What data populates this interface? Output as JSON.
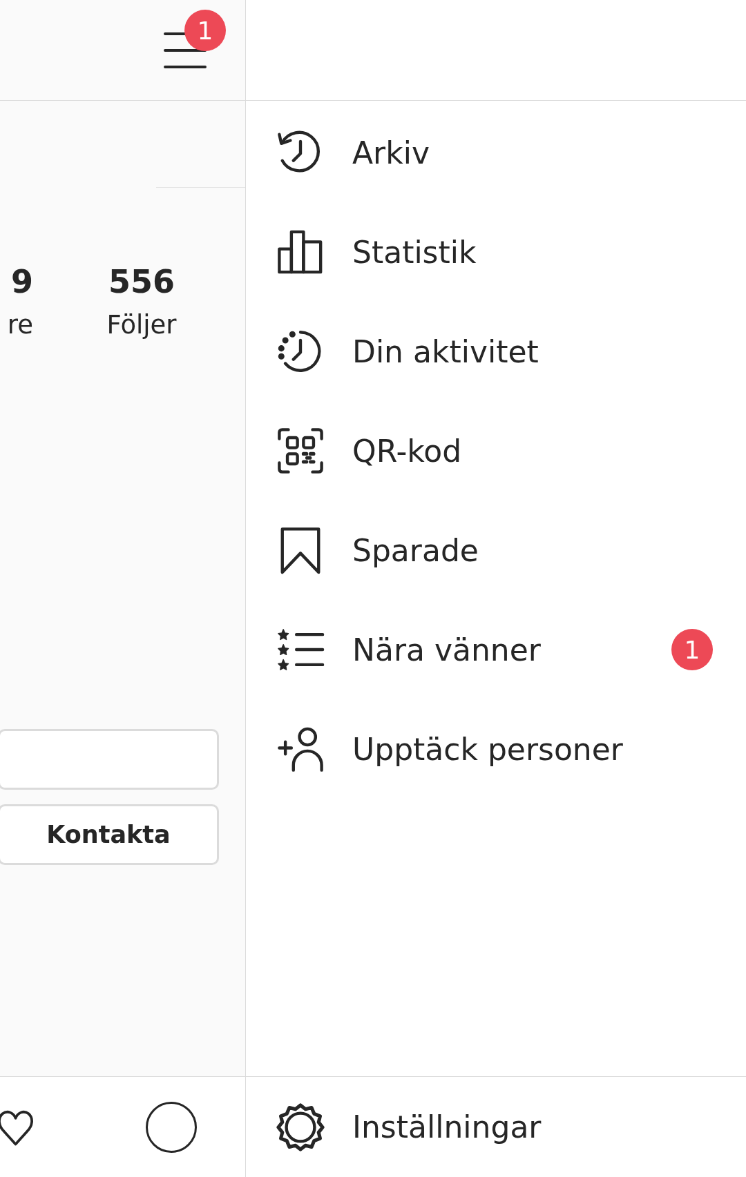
{
  "header": {
    "badge": "1"
  },
  "stats": [
    {
      "value": "9",
      "label": "re"
    },
    {
      "value": "556",
      "label": "Följer"
    }
  ],
  "buttons": [
    {
      "kind": "blank"
    },
    {
      "kind": "text",
      "label": "Kontakta"
    }
  ],
  "nav": [
    {
      "kind": "heart"
    },
    {
      "kind": "profile"
    }
  ],
  "drawer": {
    "items": [
      {
        "kind": "archive",
        "label": "Arkiv"
      },
      {
        "kind": "insights",
        "label": "Statistik"
      },
      {
        "kind": "activity",
        "label": "Din aktivitet"
      },
      {
        "kind": "qr",
        "label": "QR-kod"
      },
      {
        "kind": "saved",
        "label": "Sparade"
      },
      {
        "kind": "close-friends",
        "label": "Nära vänner",
        "badge": "1"
      },
      {
        "kind": "discover",
        "label": "Upptäck personer"
      }
    ],
    "footer": {
      "kind": "settings",
      "label": "Inställningar"
    }
  }
}
